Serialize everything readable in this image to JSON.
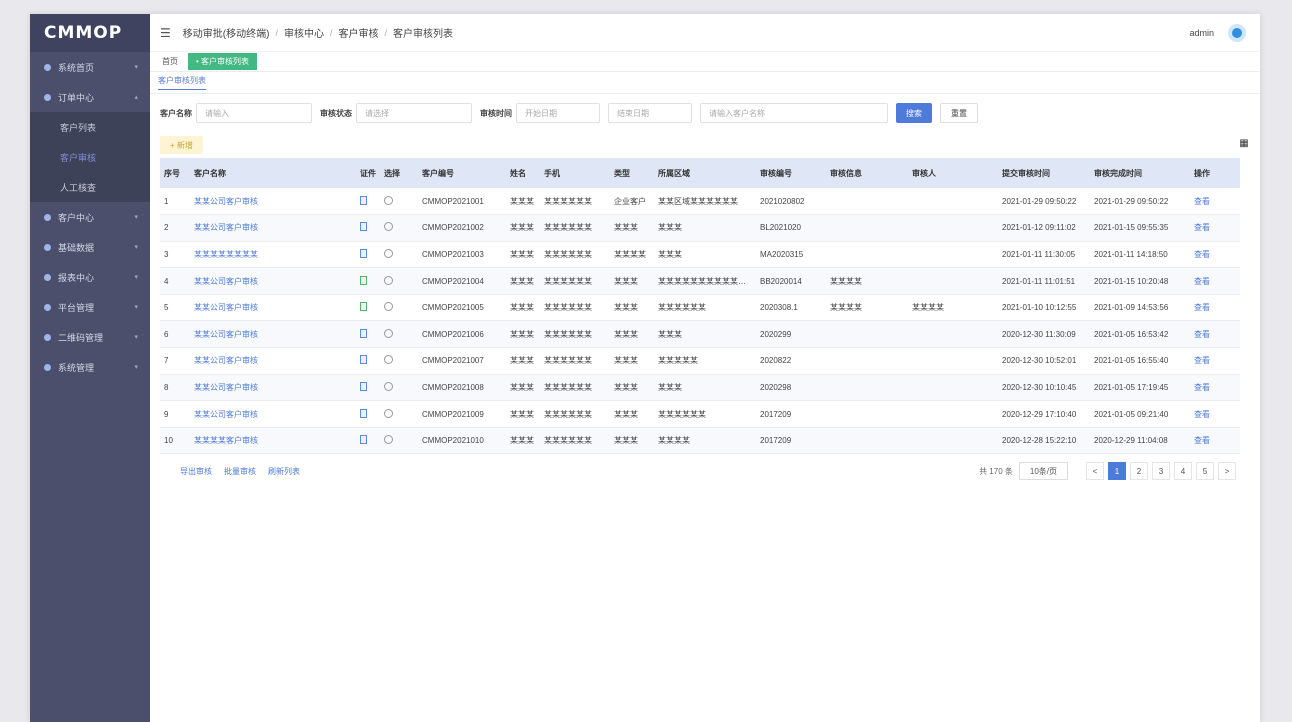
{
  "app": {
    "logo": "CMMOP"
  },
  "sidebar": {
    "items": [
      {
        "label": "系统首页",
        "icon": "home-icon"
      },
      {
        "label": "订单中心",
        "icon": "order-icon",
        "expanded": true
      },
      {
        "label": "客户中心",
        "icon": "user-icon"
      },
      {
        "label": "基础数据",
        "icon": "grid-icon"
      },
      {
        "label": "报表中心",
        "icon": "chart-icon"
      },
      {
        "label": "平台管理",
        "icon": "platform-icon"
      },
      {
        "label": "二维码管理",
        "icon": "qrcode-icon"
      },
      {
        "label": "系统管理",
        "icon": "setting-icon"
      }
    ],
    "subitems": [
      {
        "label": "客户列表",
        "active": false
      },
      {
        "label": "客户审核",
        "active": true
      },
      {
        "label": "人工核查",
        "active": false
      }
    ]
  },
  "header": {
    "menu_icon": "hamburger-icon",
    "breadcrumb": [
      "移动审批(移动终端)",
      "审核中心",
      "客户审核",
      "客户审核列表"
    ],
    "user": "admin",
    "avatar_icon": "avatar-icon"
  },
  "tags": [
    {
      "label": "首页",
      "active": false
    },
    {
      "label": "• 客户审核列表",
      "active": true
    }
  ],
  "page_subtitle": "客户审核列表",
  "filters": {
    "customer_label": "客户名称",
    "customer_placeholder": "请输入",
    "status_label": "审核状态",
    "status_placeholder": "请选择",
    "date_label": "审核时间",
    "start_placeholder": "开始日期",
    "end_placeholder": "结束日期",
    "keyword_placeholder": "请输入客户名称",
    "search_btn": "搜索",
    "reset_btn": "重置"
  },
  "toolbar": {
    "add_btn": "+ 新增",
    "columns_icon": "columns-icon"
  },
  "table": {
    "columns": [
      "序号",
      "客户名称",
      "证件",
      "选择",
      "客户编号",
      "姓名",
      "手机",
      "类型",
      "所属区域",
      "审核编号",
      "审核信息",
      "审核人",
      "提交审核时间",
      "审核完成时间",
      "操作"
    ],
    "rows": [
      {
        "idx": "1",
        "name": "某某公司客户审核",
        "doc": "blue",
        "code": "CMMOP2021001",
        "person": "某某某",
        "phone": "某某某某某某",
        "type": "企业客户",
        "area": "某某区域某某某某某某",
        "num": "2021020802",
        "info": "",
        "reviewer": "",
        "submit": "2021-01-29 09:50:22",
        "finish": "2021-01-29 09:50:22",
        "op": "查看"
      },
      {
        "idx": "2",
        "name": "某某公司客户审核",
        "doc": "blue",
        "code": "CMMOP2021002",
        "person": "某某某",
        "phone": "某某某某某某",
        "type": "某某某",
        "area": "某某某",
        "num": "BL2021020",
        "info": "",
        "reviewer": "",
        "submit": "2021-01-12 09:11:02",
        "finish": "2021-01-15 09:55:35",
        "op": "查看"
      },
      {
        "idx": "3",
        "name": "某某某某某某某某",
        "doc": "blue",
        "code": "CMMOP2021003",
        "person": "某某某",
        "phone": "某某某某某某",
        "type": "某某某某",
        "area": "某某某",
        "num": "MA2020315",
        "info": "",
        "reviewer": "",
        "submit": "2021-01-11 11:30:05",
        "finish": "2021-01-11 14:18:50",
        "op": "查看"
      },
      {
        "idx": "4",
        "name": "某某公司客户审核",
        "doc": "green",
        "code": "CMMOP2021004",
        "person": "某某某",
        "phone": "某某某某某某",
        "type": "某某某",
        "area": "某某某某某某某某某某某某某",
        "num": "BB2020014",
        "info": "某某某某",
        "reviewer": "",
        "submit": "2021-01-11 11:01:51",
        "finish": "2021-01-15 10:20:48",
        "op": "查看"
      },
      {
        "idx": "5",
        "name": "某某公司客户审核",
        "doc": "green",
        "code": "CMMOP2021005",
        "person": "某某某",
        "phone": "某某某某某某",
        "type": "某某某",
        "area": "某某某某某某",
        "num": "2020308.1",
        "info": "某某某某",
        "reviewer": "某某某某",
        "submit": "2021-01-10 10:12:55",
        "finish": "2021-01-09 14:53:56",
        "op": "查看"
      },
      {
        "idx": "6",
        "name": "某某公司客户审核",
        "doc": "blue",
        "code": "CMMOP2021006",
        "person": "某某某",
        "phone": "某某某某某某",
        "type": "某某某",
        "area": "某某某",
        "num": "2020299",
        "info": "",
        "reviewer": "",
        "submit": "2020-12-30 11:30:09",
        "finish": "2021-01-05 16:53:42",
        "op": "查看"
      },
      {
        "idx": "7",
        "name": "某某公司客户审核",
        "doc": "blue",
        "code": "CMMOP2021007",
        "person": "某某某",
        "phone": "某某某某某某",
        "type": "某某某",
        "area": "某某某某某",
        "num": "2020822",
        "info": "",
        "reviewer": "",
        "submit": "2020-12-30 10:52:01",
        "finish": "2021-01-05 16:55:40",
        "op": "查看"
      },
      {
        "idx": "8",
        "name": "某某公司客户审核",
        "doc": "blue",
        "code": "CMMOP2021008",
        "person": "某某某",
        "phone": "某某某某某某",
        "type": "某某某",
        "area": "某某某",
        "num": "2020298",
        "info": "",
        "reviewer": "",
        "submit": "2020-12-30 10:10:45",
        "finish": "2021-01-05 17:19:45",
        "op": "查看"
      },
      {
        "idx": "9",
        "name": "某某公司客户审核",
        "doc": "blue",
        "code": "CMMOP2021009",
        "person": "某某某",
        "phone": "某某某某某某",
        "type": "某某某",
        "area": "某某某某某某",
        "num": "2017209",
        "info": "",
        "reviewer": "",
        "submit": "2020-12-29 17:10:40",
        "finish": "2021-01-05 09:21:40",
        "op": "查看"
      },
      {
        "idx": "10",
        "name": "某某某某客户审核",
        "doc": "blue",
        "code": "CMMOP2021010",
        "person": "某某某",
        "phone": "某某某某某某",
        "type": "某某某",
        "area": "某某某某",
        "num": "2017209",
        "info": "",
        "reviewer": "",
        "submit": "2020-12-28 15:22:10",
        "finish": "2020-12-29 11:04:08",
        "op": "查看"
      }
    ]
  },
  "pager": {
    "links": [
      "导出审核",
      "批量审核",
      "刷新列表"
    ],
    "total": "共 170 条",
    "page_size": "10条/页",
    "prev": "<",
    "pages": [
      "1",
      "2",
      "3",
      "4",
      "5"
    ],
    "next": ">",
    "active_page": "1"
  },
  "colors": {
    "sidebar": "#4b4f6b",
    "accent": "#4e7bd9",
    "tag_active": "#42b883",
    "header_row": "#dfe7f6"
  }
}
